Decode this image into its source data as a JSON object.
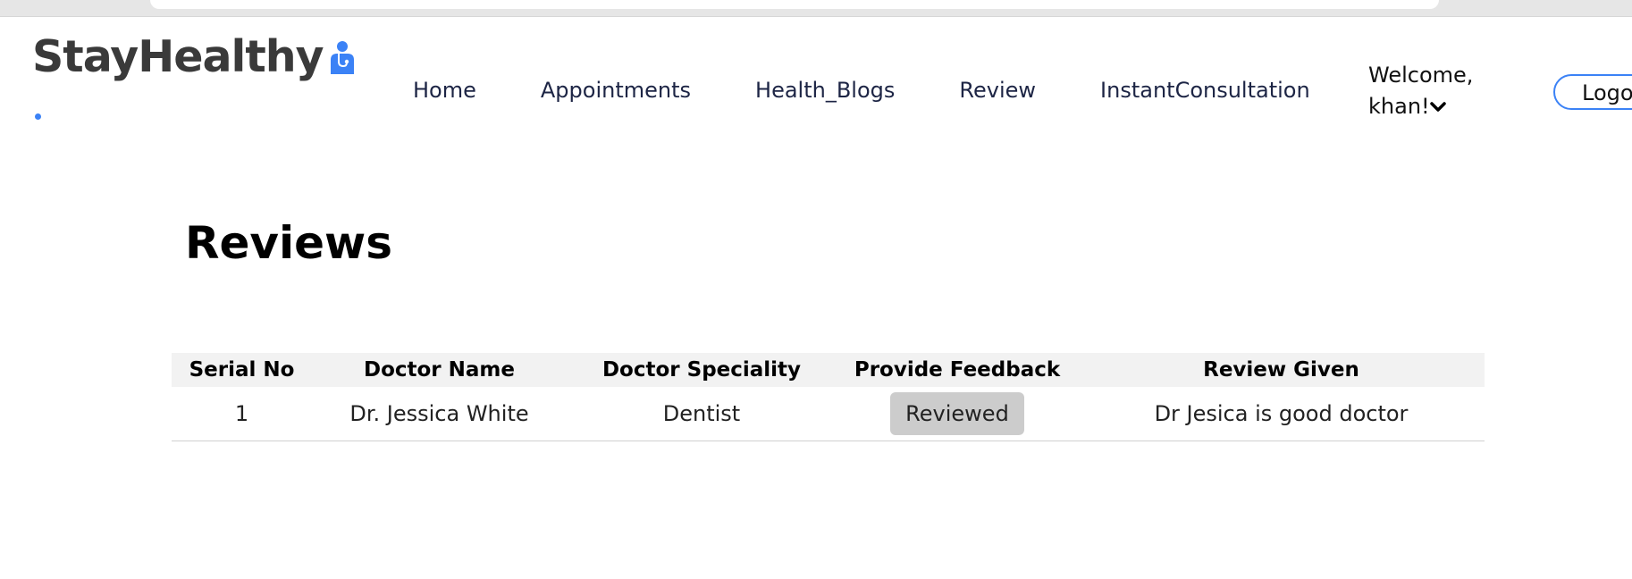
{
  "brand": {
    "name": "StayHealthy",
    "accent_color": "#3b82f6",
    "icon": "doctor-icon"
  },
  "nav": {
    "links": [
      "Home",
      "Appointments",
      "Health_Blogs",
      "Review",
      "InstantConsultation"
    ],
    "welcome_line1": "Welcome,",
    "welcome_line2": "khan!",
    "dropdown_icon": "chevron-down-icon",
    "logout_label": "Logo"
  },
  "main": {
    "title": "Reviews",
    "table": {
      "headers": [
        "Serial No",
        "Doctor Name",
        "Doctor Speciality",
        "Provide Feedback",
        "Review Given"
      ],
      "rows": [
        {
          "serial": "1",
          "doctor_name": "Dr. Jessica White",
          "speciality": "Dentist",
          "feedback_button": "Reviewed",
          "review": "Dr Jesica is good doctor"
        }
      ]
    }
  }
}
